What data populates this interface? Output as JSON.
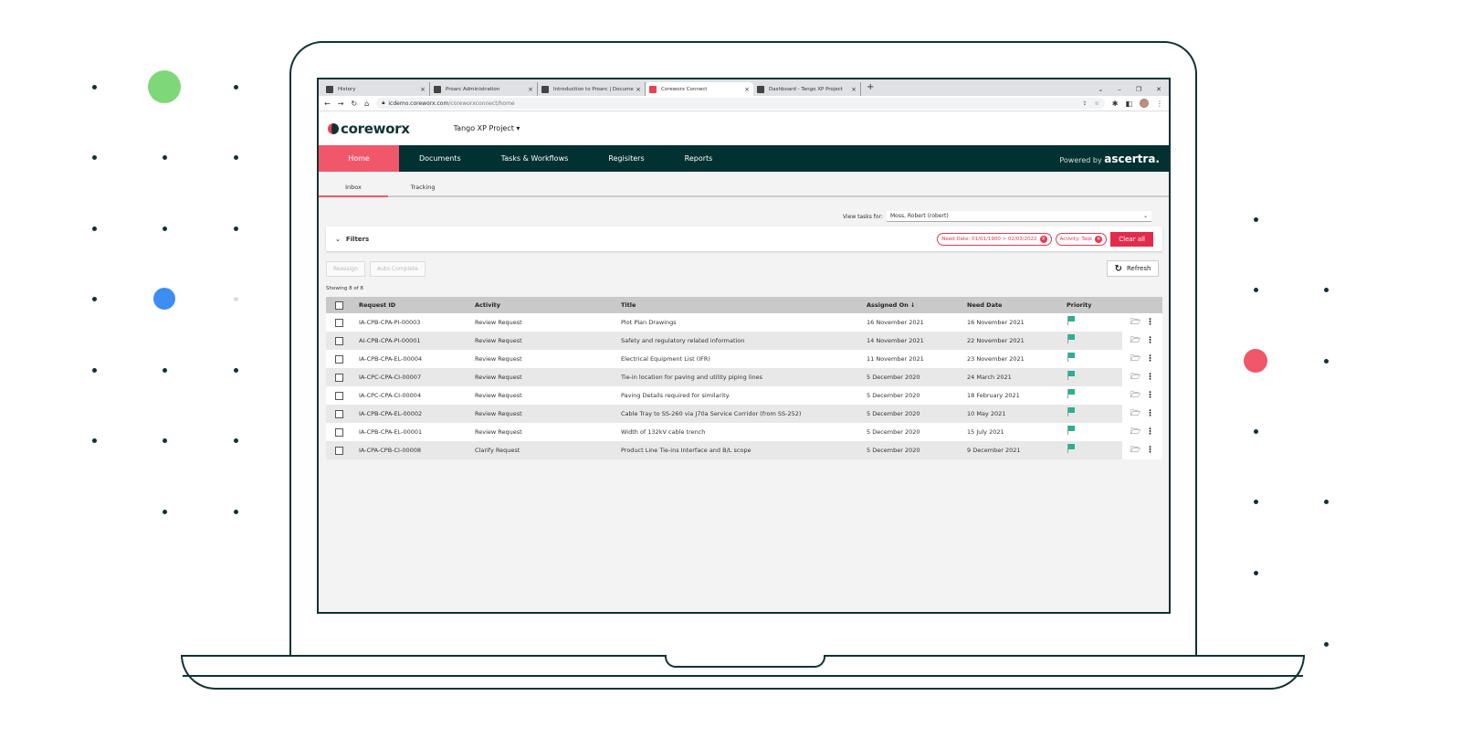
{
  "browser": {
    "tabs": [
      {
        "label": "History",
        "active": false
      },
      {
        "label": "Proarc Administration",
        "active": false
      },
      {
        "label": "Introduction to Proarc | Docume",
        "active": false
      },
      {
        "label": "Coreworx Connect",
        "active": true
      },
      {
        "label": "Dashboard - Tango XP Project",
        "active": false
      }
    ],
    "url_host": "icdemo.coreworx.com",
    "url_path": "/coreworxconnect/home"
  },
  "app": {
    "logo": "coreworx",
    "project": "Tango XP Project",
    "nav": [
      "Home",
      "Documents",
      "Tasks & Workflows",
      "Regisiters",
      "Reports"
    ],
    "powered_prefix": "Powered by",
    "powered_brand": "ascertra.",
    "subnav": [
      "Inbox",
      "Tracking"
    ]
  },
  "inbox": {
    "view_tasks_label": "View tasks for:",
    "view_tasks_value": "Moss, Robert (robert)",
    "filters_label": "Filters",
    "chips": [
      "Need Date: 01/01/1900 > 02/03/2022",
      "Activity: Task"
    ],
    "clear_all": "Clear all",
    "reassign": "Reassign",
    "auto_complete": "Auto Complete",
    "refresh": "Refresh",
    "showing": "Showing 8 of 8",
    "columns": [
      "Request ID",
      "Activity",
      "Title",
      "Assigned On ↓",
      "Need Date",
      "Priority"
    ],
    "rows": [
      [
        "IA-CPB-CPA-PI-00003",
        "Review Request",
        "Plot Plan Drawings",
        "16 November 2021",
        "16 November 2021"
      ],
      [
        "AI-CPB-CPA-PI-00001",
        "Review Request",
        "Safety and regulatory related information",
        "14 November 2021",
        "22 November 2021"
      ],
      [
        "IA-CPB-CPA-EL-00004",
        "Review Request",
        "Electrical Equipment List (IFR)",
        "11 November 2021",
        "23 November 2021"
      ],
      [
        "IA-CPC-CPA-CI-00007",
        "Review Request",
        "Tie-in location for paving and utility piping lines",
        "5 December 2020",
        "24 March 2021"
      ],
      [
        "IA-CPC-CPA-CI-00004",
        "Review Request",
        "Paving Details required for similarity.",
        "5 December 2020",
        "18 February 2021"
      ],
      [
        "IA-CPB-CPA-EL-00002",
        "Review Request",
        "Cable Tray to SS-260 via J70a Service Corridor (from SS-252)",
        "5 December 2020",
        "10 May 2021"
      ],
      [
        "IA-CPB-CPA-EL-00001",
        "Review Request",
        "Width of 132kV cable trench",
        "5 December 2020",
        "15 July 2021"
      ],
      [
        "IA-CPA-CPB-CI-00008",
        "Clarify Request",
        "Product Line Tie-ins Interface and B/L scope",
        "5 December 2020",
        "9 December 2021"
      ]
    ]
  },
  "colors": {
    "accent": "#f0576a",
    "nav": "#023131",
    "flag": "#2bb08f",
    "danger": "#e32c4c"
  }
}
